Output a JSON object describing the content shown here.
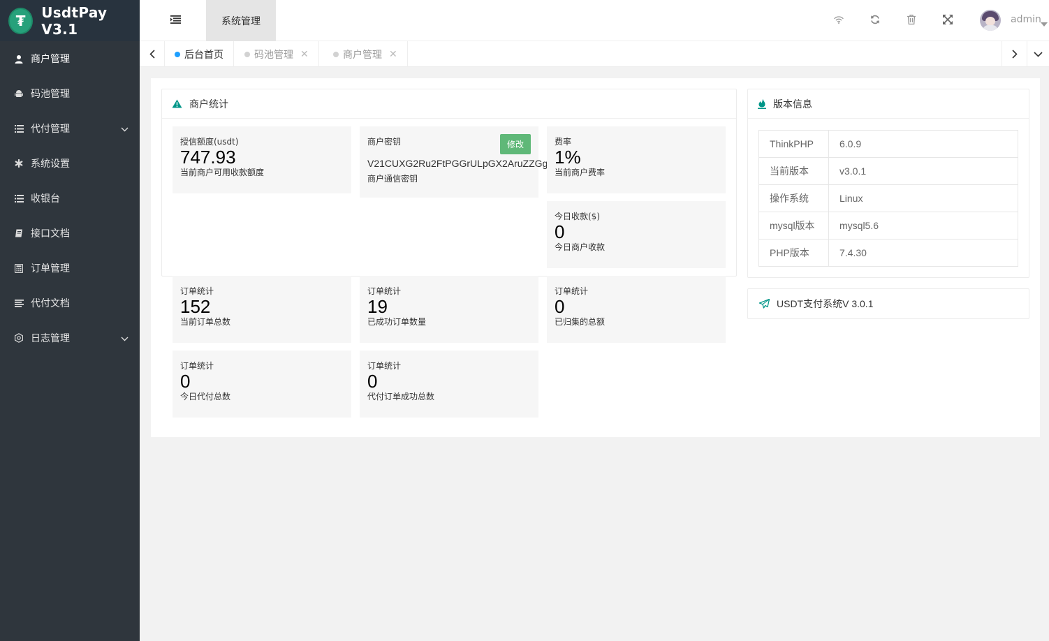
{
  "app": {
    "title": "UsdtPay V3.1",
    "logo_glyph": "₮"
  },
  "sidebar": {
    "items": [
      {
        "label": "商户管理",
        "icon": "user-icon"
      },
      {
        "label": "码池管理",
        "icon": "android-icon"
      },
      {
        "label": "代付管理",
        "icon": "list-icon",
        "expandable": true
      },
      {
        "label": "系统设置",
        "icon": "asterisk-icon"
      },
      {
        "label": "收银台",
        "icon": "list-icon"
      },
      {
        "label": "接口文档",
        "icon": "book-icon"
      },
      {
        "label": "订单管理",
        "icon": "calculator-icon"
      },
      {
        "label": "代付文档",
        "icon": "align-icon"
      },
      {
        "label": "日志管理",
        "icon": "settings-icon",
        "expandable": true
      }
    ]
  },
  "header": {
    "menu_tab": "系统管理",
    "icons": [
      "wifi-icon",
      "refresh-icon",
      "trash-icon",
      "fullscreen-icon"
    ],
    "username": "admin"
  },
  "tabs": [
    {
      "label": "后台首页",
      "active": true,
      "closable": false
    },
    {
      "label": "码池管理",
      "active": false,
      "closable": true
    },
    {
      "label": "商户管理",
      "active": false,
      "closable": true
    }
  ],
  "merchant_stats": {
    "title": "商户统计",
    "credit": {
      "title": "授信额度(usdt)",
      "value": "747.93",
      "subtitle": "当前商户可用收款额度"
    },
    "secret": {
      "title": "商户密钥",
      "value": "V21CUXG2Ru2FtPGGrULpGX2AruZZGg",
      "subtitle": "商户通信密钥",
      "edit_label": "修改"
    },
    "rate": {
      "title": "费率",
      "value": "1%",
      "subtitle": "当前商户费率"
    },
    "today_income": {
      "title": "今日收款($)",
      "value": "0",
      "subtitle": "今日商户收款"
    }
  },
  "order_stats": [
    {
      "title": "订单统计",
      "value": "152",
      "subtitle": "当前订单总数"
    },
    {
      "title": "订单统计",
      "value": "19",
      "subtitle": "已成功订单数量"
    },
    {
      "title": "订单统计",
      "value": "0",
      "subtitle": "已归集的总额"
    },
    {
      "title": "订单统计",
      "value": "0",
      "subtitle": "今日代付总数"
    },
    {
      "title": "订单统计",
      "value": "0",
      "subtitle": "代付订单成功总数"
    }
  ],
  "version_info": {
    "title": "版本信息",
    "rows": [
      {
        "key": "ThinkPHP",
        "value": "6.0.9"
      },
      {
        "key": "当前版本",
        "value": "v3.0.1"
      },
      {
        "key": "操作系统",
        "value": "Linux"
      },
      {
        "key": "mysql版本",
        "value": "mysql5.6"
      },
      {
        "key": "PHP版本",
        "value": "7.4.30"
      }
    ]
  },
  "system_card": {
    "label": "USDT支付系统V 3.0.1"
  },
  "colors": {
    "sidebar_bg": "#2f363d",
    "accent_green": "#5fb878",
    "brand_teal": "#26a17b",
    "tab_active_dot": "#1e9fff",
    "card_icon": "#009688"
  }
}
